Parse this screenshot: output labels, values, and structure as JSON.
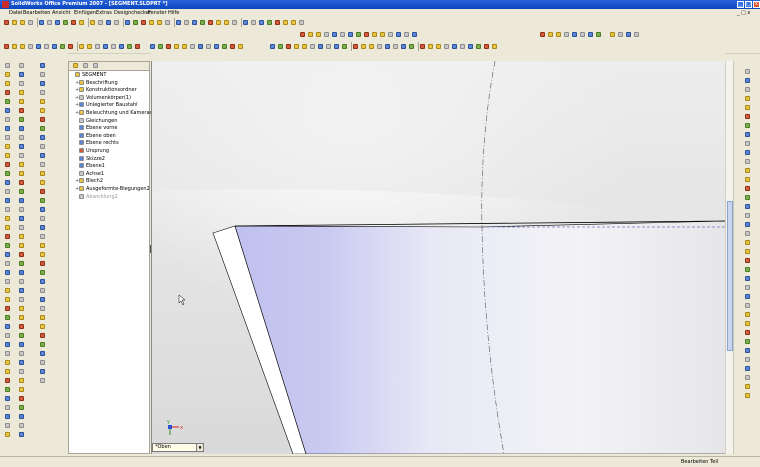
{
  "window": {
    "title": "SolidWorks Office Premium 2007 - [SEGMENT.SLDPRT *]",
    "buttons": {
      "minimize": "_",
      "maximize": "□",
      "close": "x"
    }
  },
  "menu": {
    "items": [
      "Datei",
      "Bearbeiten",
      "Ansicht",
      "Einfügen",
      "Extras",
      "Designchecker",
      "Fenster",
      "Hilfe"
    ]
  },
  "tree": {
    "items": [
      {
        "label": "SEGMENT",
        "icon": "part-icon",
        "level": 0
      },
      {
        "label": "Beschriftung",
        "icon": "annotation-icon",
        "level": 1
      },
      {
        "label": "Konstruktionsordner",
        "icon": "folder-icon",
        "level": 1
      },
      {
        "label": "Volumenkörper(1)",
        "icon": "solid-bodies-icon",
        "level": 1
      },
      {
        "label": "Unlegierter Baustahl",
        "icon": "material-icon",
        "level": 1
      },
      {
        "label": "Beleuchtung und Kameras",
        "icon": "lights-icon",
        "level": 1
      },
      {
        "label": "Gleichungen",
        "icon": "equations-icon",
        "level": 1
      },
      {
        "label": "Ebene vorne",
        "icon": "plane-icon",
        "level": 1
      },
      {
        "label": "Ebene oben",
        "icon": "plane-icon",
        "level": 1
      },
      {
        "label": "Ebene rechts",
        "icon": "plane-icon",
        "level": 1
      },
      {
        "label": "Ursprung",
        "icon": "origin-icon",
        "level": 1
      },
      {
        "label": "Skizze2",
        "icon": "sketch-icon",
        "level": 1
      },
      {
        "label": "Ebene1",
        "icon": "plane-icon",
        "level": 1
      },
      {
        "label": "Achse1",
        "icon": "axis-icon",
        "level": 1
      },
      {
        "label": "Blech2",
        "icon": "sheetmetal-icon",
        "level": 1
      },
      {
        "label": "Ausgeformte-Biegungen2",
        "icon": "lofted-bend-icon",
        "level": 1
      },
      {
        "label": "Abwicklung2",
        "icon": "flatten-icon",
        "level": 1
      }
    ]
  },
  "viewport": {
    "orientation": "*Oben",
    "triad_axes": [
      "x",
      "y"
    ]
  },
  "status": {
    "text": "Bearbeiten Teil"
  },
  "colors": {
    "titlebar": "#0a46c0",
    "model_face": "#d6d6f2",
    "model_edge": "#000000",
    "background_top": "#e8e8e8"
  }
}
